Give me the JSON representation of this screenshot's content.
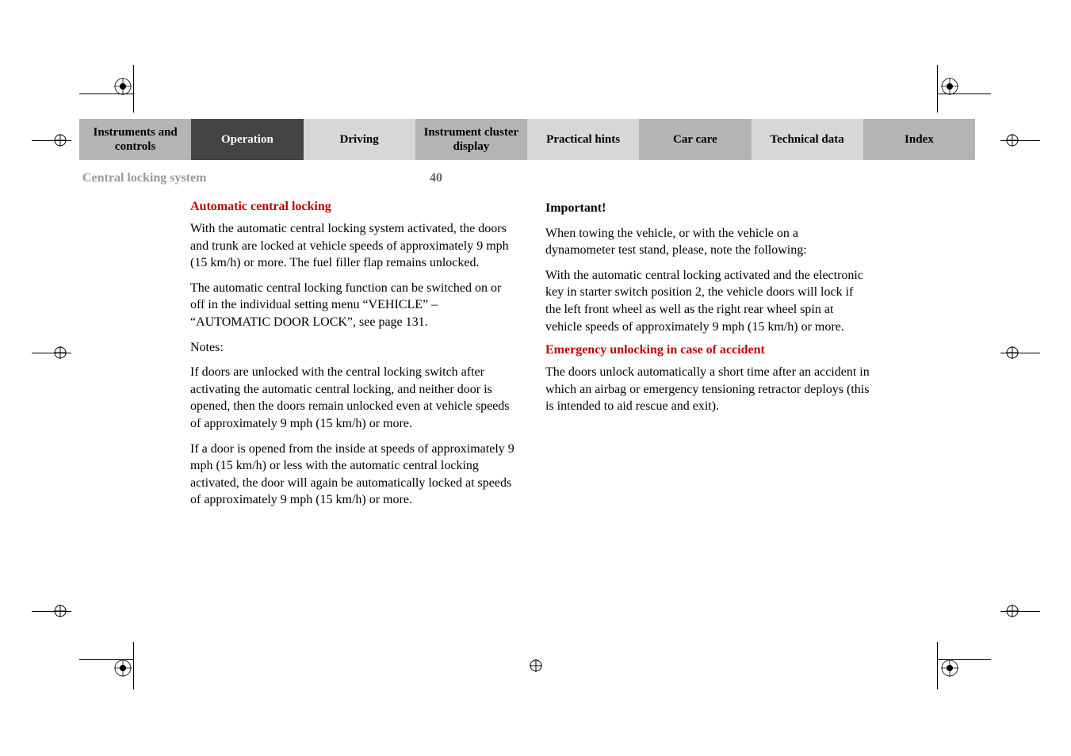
{
  "tabs": [
    "Instruments and controls",
    "Operation",
    "Driving",
    "Instrument cluster display",
    "Practical hints",
    "Car care",
    "Technical data",
    "Index"
  ],
  "section_title": "Central locking system",
  "page_number": "40",
  "left": {
    "h1": "Automatic central locking",
    "p1": "With the automatic central locking system activated, the doors and trunk are locked at vehicle speeds of approximately 9 mph (15 km/h) or more. The fuel filler flap remains unlocked.",
    "p2": "The automatic central locking function can be switched on or off in the individual setting menu “VEHICLE” – “AUTOMATIC DOOR LOCK”, see page 131.",
    "notes": "Notes:",
    "p3": "If doors are unlocked with the central locking switch after activating the automatic central locking, and neither door is opened, then the doors remain unlocked even at vehicle speeds of approximately 9 mph (15 km/h) or more.",
    "p4": "If a door is opened from the inside at speeds of approximately 9 mph (15 km/h) or less with the automatic central locking activated, the door will again be automatically locked at speeds of approximately 9 mph (15 km/h) or more."
  },
  "right": {
    "important": "Important!",
    "p1": "When towing the vehicle, or with the vehicle on a dynamometer test stand, please, note the following:",
    "p2": "With the automatic central locking activated and the electronic key in starter switch position 2, the vehicle doors will lock if the left front wheel as well as the right rear wheel spin at vehicle speeds of approximately 9 mph (15 km/h) or more.",
    "h2": "Emergency unlocking in case of accident",
    "p3": "The doors unlock automatically a short time after an accident in which an airbag or emergency tensioning retractor deploys (this is intended to aid rescue and exit)."
  }
}
